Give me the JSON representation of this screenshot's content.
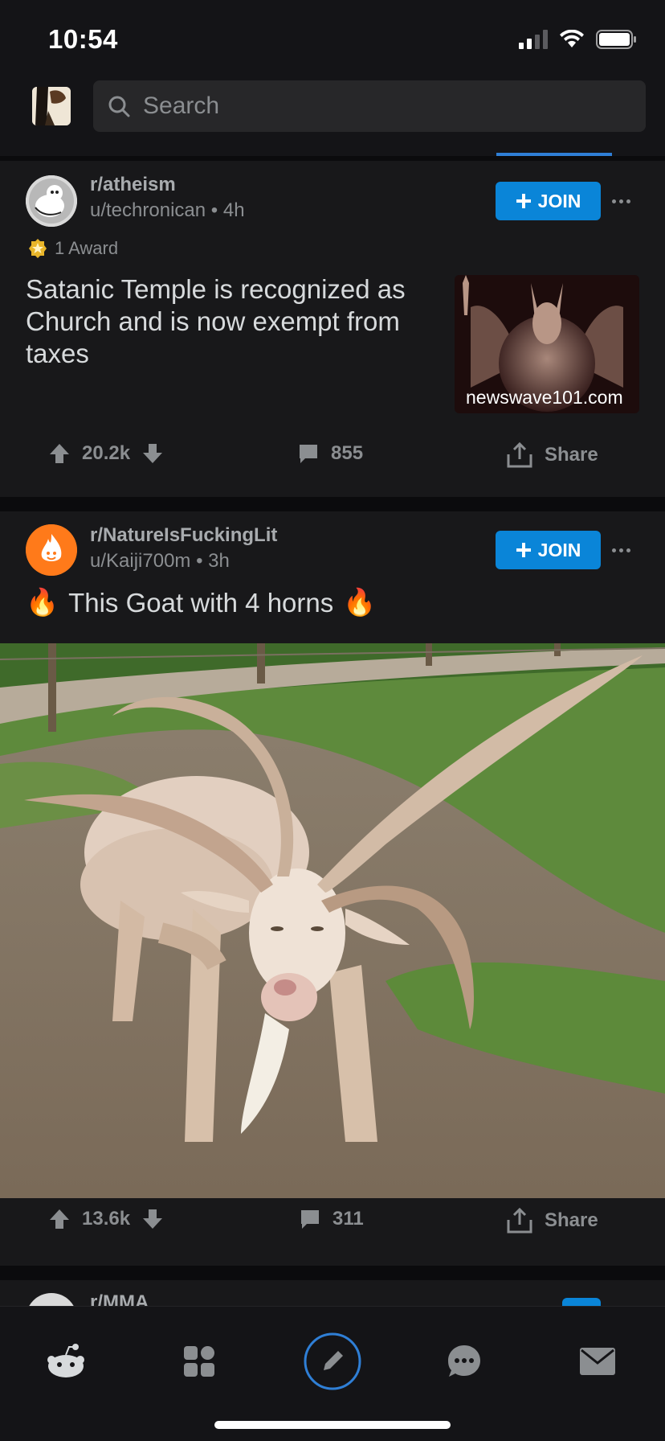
{
  "status_bar": {
    "time": "10:54"
  },
  "header": {
    "search_placeholder": "Search"
  },
  "posts": [
    {
      "subreddit": "r/atheism",
      "author": "u/techronican",
      "age": "4h",
      "join_label": "JOIN",
      "awards": "1 Award",
      "title": "Satanic Temple is recognized as Church and is now exempt from taxes",
      "thumbnail_caption": "newswave101.com",
      "upvotes": "20.2k",
      "comments": "855",
      "share_label": "Share"
    },
    {
      "subreddit": "r/NatureIsFuckingLit",
      "author": "u/Kaiji700m",
      "age": "3h",
      "join_label": "JOIN",
      "title_emoji": "🔥",
      "title": "This Goat with 4 horns",
      "upvotes": "13.6k",
      "comments": "311",
      "share_label": "Share"
    },
    {
      "subreddit": "r/MMA"
    }
  ],
  "bottom_nav": {
    "items": [
      "home-icon",
      "communities-icon",
      "create-post-icon",
      "chat-icon",
      "inbox-icon"
    ]
  },
  "colors": {
    "accent": "#0a85d8",
    "background": "#0b0b0d",
    "card": "#18181a",
    "orange_avatar": "#ff7a1a"
  }
}
